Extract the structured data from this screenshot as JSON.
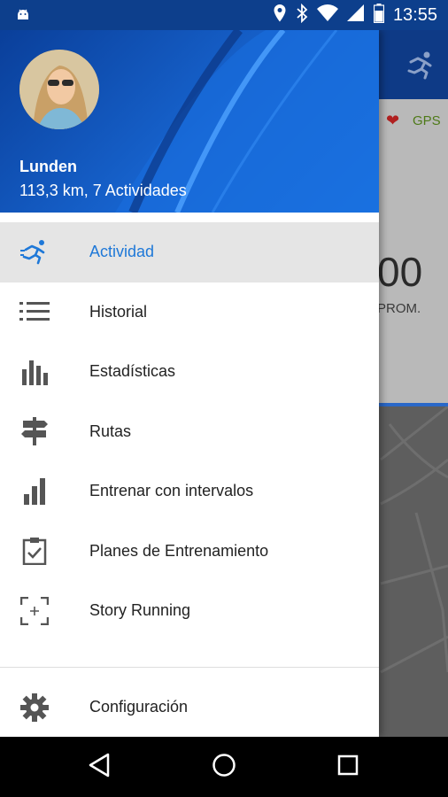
{
  "status_bar": {
    "time": "13:55",
    "icons": [
      "android-icon",
      "location-icon",
      "bluetooth-icon",
      "wifi-icon",
      "signal-icon",
      "battery-icon"
    ]
  },
  "background": {
    "gps_label": "GPS",
    "big_value": "00",
    "prom_label": "PROM."
  },
  "drawer": {
    "user_name": "Lunden",
    "user_stats": "113,3 km, 7 Actividades",
    "items": [
      {
        "label": "Actividad",
        "icon": "runner-icon",
        "active": true
      },
      {
        "label": "Historial",
        "icon": "list-icon",
        "active": false
      },
      {
        "label": "Estadísticas",
        "icon": "bar-stats-icon",
        "active": false
      },
      {
        "label": "Rutas",
        "icon": "signpost-icon",
        "active": false
      },
      {
        "label": "Entrenar con intervalos",
        "icon": "intervals-icon",
        "active": false
      },
      {
        "label": "Planes de Entrenamiento",
        "icon": "clipboard-check-icon",
        "active": false
      },
      {
        "label": "Story Running",
        "icon": "story-frame-icon",
        "active": false
      }
    ],
    "settings_label": "Configuración"
  },
  "colors": {
    "accent": "#1e78d8",
    "header_dark": "#0a3f9a",
    "header_light": "#1a73e0"
  }
}
